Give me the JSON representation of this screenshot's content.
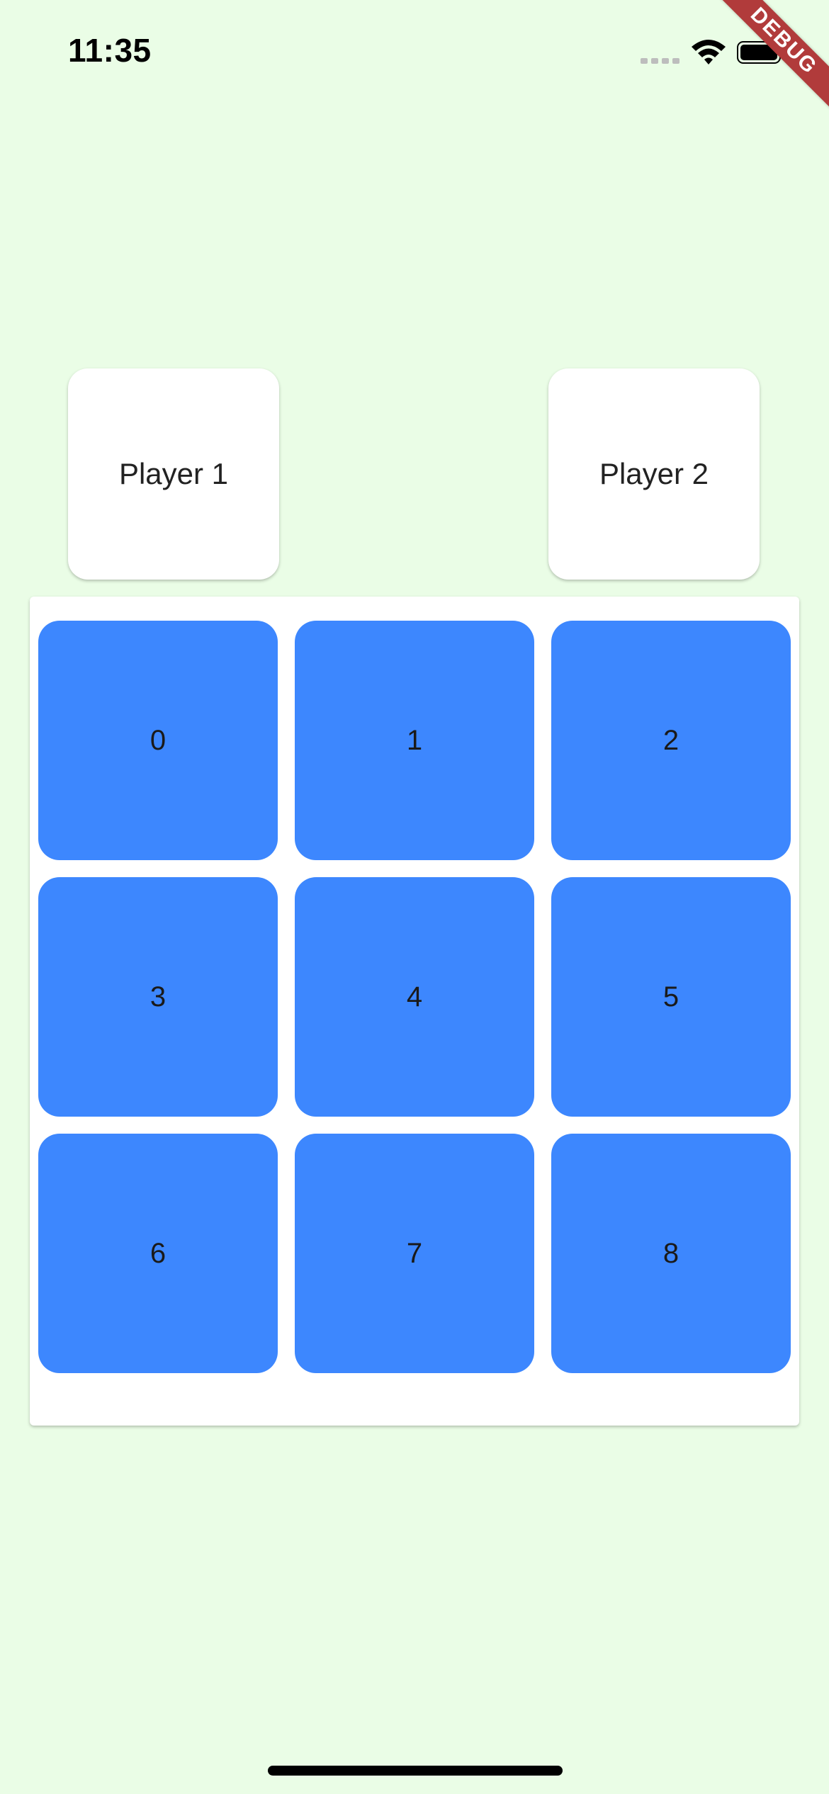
{
  "status_bar": {
    "time": "11:35",
    "icons": [
      "signal-dots-icon",
      "wifi-icon",
      "battery-icon"
    ]
  },
  "debug_banner": {
    "label": "DEBUG"
  },
  "players": [
    {
      "label": "Player 1"
    },
    {
      "label": "Player 2"
    }
  ],
  "board": {
    "cells": [
      {
        "label": "0"
      },
      {
        "label": "1"
      },
      {
        "label": "2"
      },
      {
        "label": "3"
      },
      {
        "label": "4"
      },
      {
        "label": "5"
      },
      {
        "label": "6"
      },
      {
        "label": "7"
      },
      {
        "label": "8"
      }
    ]
  },
  "colors": {
    "background": "#EAFDE6",
    "cell": "#3D87FE",
    "card": "#FFFFFF",
    "debug_ribbon": "#B13B3B"
  }
}
